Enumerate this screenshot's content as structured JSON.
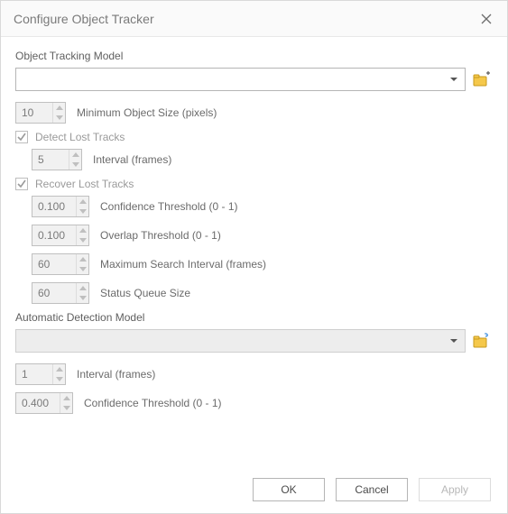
{
  "title": "Configure Object Tracker",
  "section1": {
    "label": "Object Tracking Model"
  },
  "minObjSize": {
    "value": "10",
    "label": "Minimum Object Size (pixels)"
  },
  "detectLost": {
    "label": "Detect Lost Tracks",
    "interval": {
      "value": "5",
      "label": "Interval (frames)"
    }
  },
  "recoverLost": {
    "label": "Recover Lost Tracks",
    "conf": {
      "value": "0.100",
      "label": "Confidence Threshold (0 - 1)"
    },
    "overlap": {
      "value": "0.100",
      "label": "Overlap Threshold (0 - 1)"
    },
    "maxSearch": {
      "value": "60",
      "label": "Maximum Search Interval (frames)"
    },
    "statusQ": {
      "value": "60",
      "label": "Status Queue Size"
    }
  },
  "autoDetect": {
    "label": "Automatic Detection Model",
    "interval": {
      "value": "1",
      "label": "Interval (frames)"
    },
    "conf": {
      "value": "0.400",
      "label": "Confidence Threshold (0 - 1)"
    }
  },
  "buttons": {
    "ok": "OK",
    "cancel": "Cancel",
    "apply": "Apply"
  }
}
